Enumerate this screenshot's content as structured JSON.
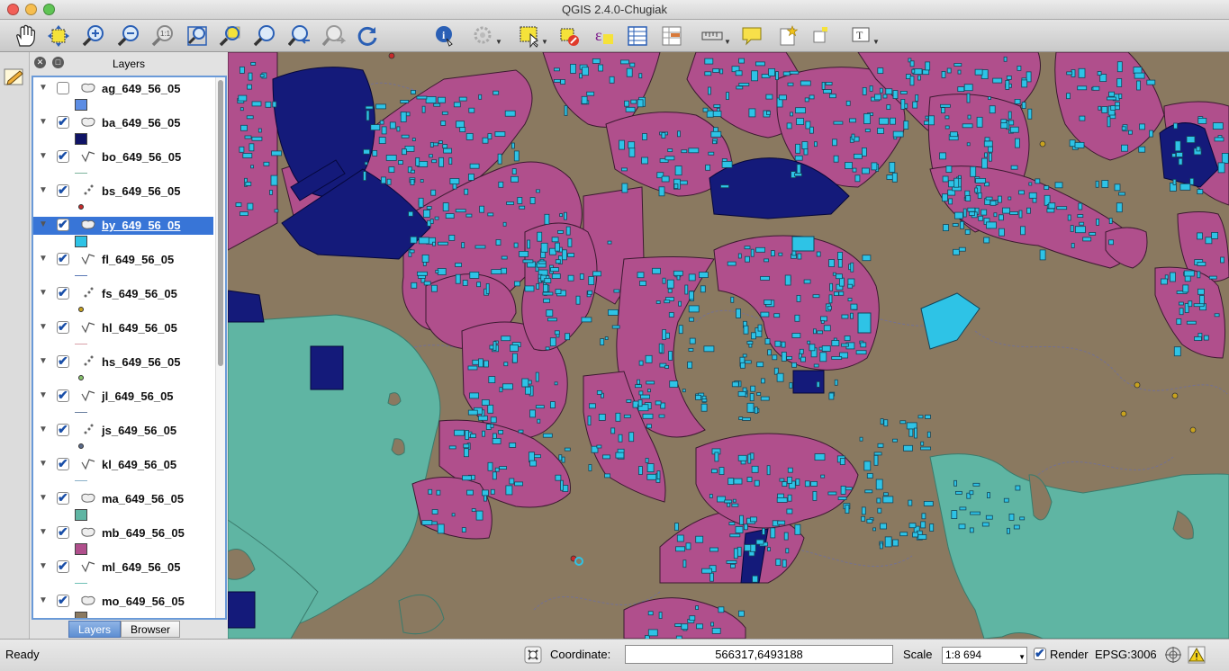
{
  "window": {
    "title": "QGIS 2.4.0-Chugiak"
  },
  "colors": {
    "background_land": "#8a7960",
    "urban_area": "#b04f8c",
    "buildings": "#2ec3e6",
    "dark_blue_area": "#141a7a",
    "water_teal": "#5fb5a3",
    "selection": "#3875d7"
  },
  "toolbar": {
    "tools": [
      "pan-icon",
      "pan-to-selection-icon",
      "zoom-in-icon",
      "zoom-out-icon",
      "zoom-actual-icon",
      "zoom-full-icon",
      "zoom-to-selection-icon",
      "zoom-to-layer-icon",
      "zoom-last-icon",
      "zoom-next-icon",
      "refresh-icon",
      "identify-icon",
      "select-by-action-icon",
      "select-features-icon",
      "deselect-icon",
      "select-by-expression-icon",
      "attribute-table-icon",
      "field-calculator-icon",
      "measure-icon",
      "map-tips-icon",
      "new-bookmark-icon",
      "show-bookmarks-icon",
      "text-annotation-icon"
    ]
  },
  "layers_panel": {
    "title": "Layers",
    "tabs": [
      {
        "label": "Layers",
        "active": true
      },
      {
        "label": "Browser",
        "active": false
      }
    ],
    "layers": [
      {
        "name": "ag_649_56_05",
        "checked": false,
        "geom": "polygon",
        "symbol": "fill",
        "color": "#5c8de4",
        "selected": false
      },
      {
        "name": "ba_649_56_05",
        "checked": true,
        "geom": "polygon",
        "symbol": "fill",
        "color": "#101466",
        "selected": false
      },
      {
        "name": "bo_649_56_05",
        "checked": true,
        "geom": "line",
        "symbol": "line",
        "color": "#7db39c",
        "selected": false
      },
      {
        "name": "bs_649_56_05",
        "checked": true,
        "geom": "point",
        "symbol": "dot",
        "color": "#c72a2a",
        "selected": false
      },
      {
        "name": "by_649_56_05",
        "checked": true,
        "geom": "polygon",
        "symbol": "fill",
        "color": "#2ec3e6",
        "selected": true
      },
      {
        "name": "fl_649_56_05",
        "checked": true,
        "geom": "line",
        "symbol": "line",
        "color": "#5a78b5",
        "selected": false
      },
      {
        "name": "fs_649_56_05",
        "checked": true,
        "geom": "point",
        "symbol": "dot",
        "color": "#c8a21e",
        "selected": false
      },
      {
        "name": "hl_649_56_05",
        "checked": true,
        "geom": "line",
        "symbol": "line",
        "color": "#d9a0a8",
        "selected": false
      },
      {
        "name": "hs_649_56_05",
        "checked": true,
        "geom": "point",
        "symbol": "dot",
        "color": "#86c26a",
        "selected": false
      },
      {
        "name": "jl_649_56_05",
        "checked": true,
        "geom": "line",
        "symbol": "line",
        "color": "#6a7fa0",
        "selected": false
      },
      {
        "name": "js_649_56_05",
        "checked": true,
        "geom": "point",
        "symbol": "dot",
        "color": "#5a6a8a",
        "selected": false
      },
      {
        "name": "kl_649_56_05",
        "checked": true,
        "geom": "line",
        "symbol": "line",
        "color": "#8ab0c8",
        "selected": false
      },
      {
        "name": "ma_649_56_05",
        "checked": true,
        "geom": "polygon",
        "symbol": "fill",
        "color": "#5fb5a3",
        "selected": false
      },
      {
        "name": "mb_649_56_05",
        "checked": true,
        "geom": "polygon",
        "symbol": "fill",
        "color": "#b04f8c",
        "selected": false
      },
      {
        "name": "ml_649_56_05",
        "checked": true,
        "geom": "line",
        "symbol": "line",
        "color": "#6fc0b6",
        "selected": false
      },
      {
        "name": "mo_649_56_05",
        "checked": true,
        "geom": "polygon",
        "symbol": "fill",
        "color": "#8a7960",
        "selected": false
      }
    ]
  },
  "statusbar": {
    "status": "Ready",
    "coordinate_label": "Coordinate:",
    "coordinate_value": "566317,6493188",
    "scale_label": "Scale",
    "scale_value": "1:8 694",
    "render_label": "Render",
    "render_checked": true,
    "crs": "EPSG:3006"
  }
}
